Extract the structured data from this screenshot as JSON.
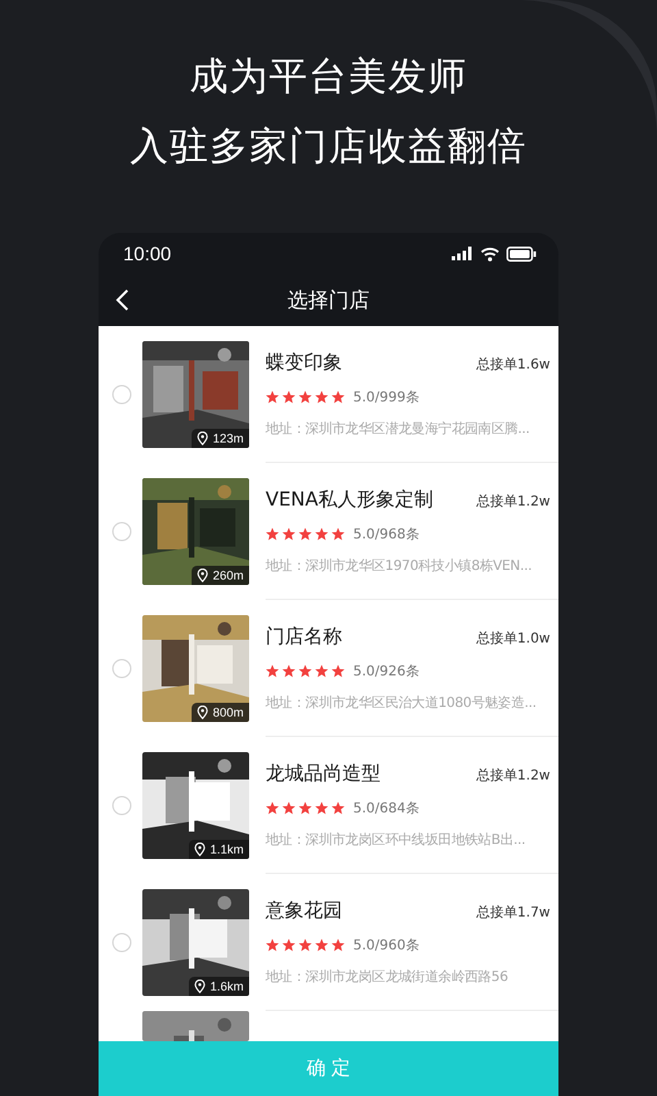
{
  "headline": [
    "成为平台美发师",
    "入驻多家门店收益翻倍"
  ],
  "status_bar": {
    "time": "10:00"
  },
  "nav": {
    "title": "选择门店"
  },
  "stores": [
    {
      "kind": "store",
      "name": "蝶变印象",
      "orders": "总接单1.6w",
      "stars": 5,
      "rating": "5.0/999条",
      "address": "地址：深圳市龙华区潜龙曼海宁花园南区腾...",
      "distance": "123m",
      "selected": false
    },
    {
      "kind": "store",
      "name": "VENA私人形象定制",
      "orders": "总接单1.2w",
      "stars": 5,
      "rating": "5.0/968条",
      "address": "地址：深圳市龙华区1970科技小镇8栋VEN...",
      "distance": "260m",
      "selected": false
    },
    {
      "kind": "store",
      "name": "门店名称",
      "orders": "总接单1.0w",
      "stars": 5,
      "rating": "5.0/926条",
      "address": "地址：深圳市龙华区民治大道1080号魅姿造...",
      "distance": "800m",
      "selected": false
    },
    {
      "kind": "store",
      "name": "龙城品尚造型",
      "orders": "总接单1.2w",
      "stars": 5,
      "rating": "5.0/684条",
      "address": "地址：深圳市龙岗区环中线坂田地铁站B出...",
      "distance": "1.1km",
      "selected": false
    },
    {
      "kind": "store",
      "name": "意象花园",
      "orders": "总接单1.7w",
      "stars": 5,
      "rating": "5.0/960条",
      "address": "地址：深圳市龙岗区龙城街道余岭西路56",
      "distance": "1.6km",
      "selected": false
    },
    {
      "kind": "picture"
    }
  ],
  "confirm_button": "确 定"
}
